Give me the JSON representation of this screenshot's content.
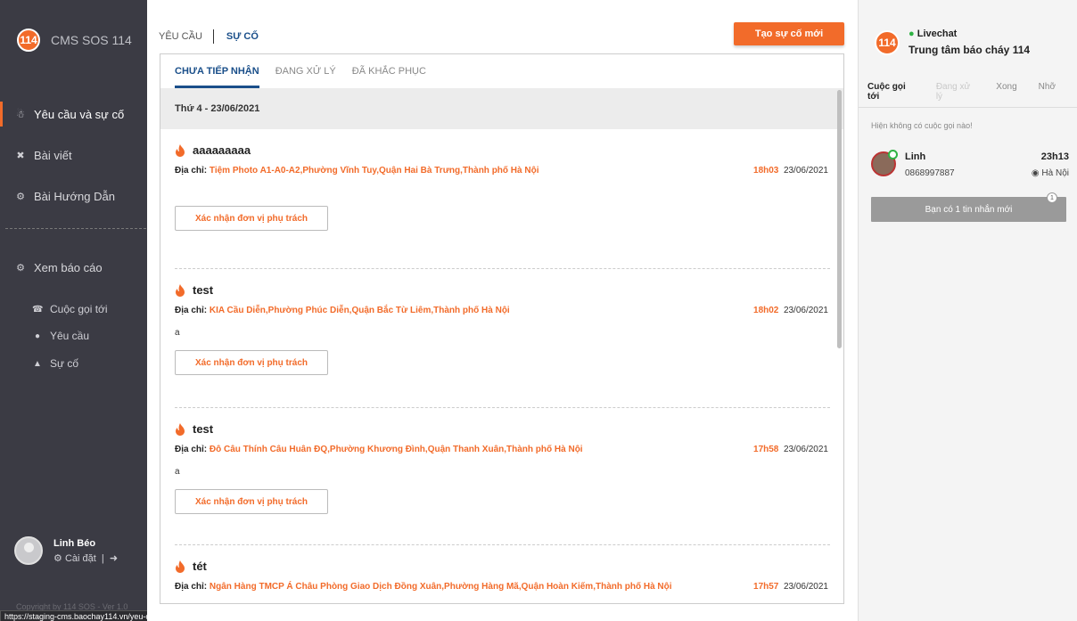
{
  "sidebar": {
    "logo": "114",
    "app_name": "CMS SOS 114",
    "nav": [
      {
        "label": "Yêu cầu và sự cố",
        "icon": "megaphone-icon"
      },
      {
        "label": "Bài viết",
        "icon": "tools-icon"
      },
      {
        "label": "Bài Hướng Dẫn",
        "icon": "settings-icon"
      },
      {
        "label": "Xem báo cáo",
        "icon": "settings-icon"
      }
    ],
    "sub_nav": [
      {
        "label": "Cuộc gọi tới",
        "icon": "phone-icon"
      },
      {
        "label": "Yêu cầu",
        "icon": "chat-icon"
      },
      {
        "label": "Sự cố",
        "icon": "fire-icon"
      }
    ],
    "user": {
      "name": "Linh Béo",
      "settings_label": "Cài đặt"
    },
    "copyright": "Copyright by 114 SOS - Ver 1.0",
    "status_url": "https://staging-cms.baochay114.vn/yeu-cau-va-su-co"
  },
  "main": {
    "top_tabs": [
      "YÊU CẦU",
      "SỰ CỐ"
    ],
    "create_button": "Tạo sự cố mới",
    "sub_tabs": [
      "CHƯA TIẾP NHẬN",
      "ĐANG XỬ LÝ",
      "ĐÃ KHẮC PHỤC"
    ],
    "date_header": "Thứ 4 - 23/06/2021",
    "address_label": "Địa chỉ:",
    "confirm_label": "Xác nhận đơn vị phụ trách",
    "incidents": [
      {
        "title": "aaaaaaaaa",
        "address": "Tiệm Photo A1-A0-A2,Phường Vĩnh Tuy,Quận Hai Bà Trưng,Thành phố Hà Nội",
        "time": "18h03",
        "date": "23/06/2021",
        "note": ""
      },
      {
        "title": "test",
        "address": "KIA Cầu Diễn,Phường Phúc Diễn,Quận Bắc Từ Liêm,Thành phố Hà Nội",
        "time": "18h02",
        "date": "23/06/2021",
        "note": "a"
      },
      {
        "title": "test",
        "address": "Đô Câu Thính Câu Huân ĐQ,Phường Khương Đình,Quận Thanh Xuân,Thành phố Hà Nội",
        "time": "17h58",
        "date": "23/06/2021",
        "note": "a"
      },
      {
        "title": "tét",
        "address": "Ngân Hàng TMCP Á Châu Phòng Giao Dịch Đồng Xuân,Phường Hàng Mã,Quận Hoàn Kiếm,Thành phố Hà Nội",
        "time": "17h57",
        "date": "23/06/2021",
        "note": ""
      }
    ]
  },
  "right": {
    "logo": "114",
    "status": "Livechat",
    "center": "Trung tâm báo cháy 114",
    "tabs": [
      "Cuộc gọi tới",
      "Đang xử lý",
      "Xong",
      "Nhỡ"
    ],
    "empty_text": "Hiện không có cuộc gọi nào!",
    "caller": {
      "name": "Linh",
      "phone": "0868997887",
      "time": "23h13",
      "location": "Hà Nội"
    },
    "message_button": "Bạn có 1 tin nhắn mới",
    "message_count": "1"
  },
  "colors": {
    "accent": "#f26b2a",
    "sidebar": "#3b3b44",
    "link": "#1a4f8a",
    "online": "#2fb344"
  }
}
